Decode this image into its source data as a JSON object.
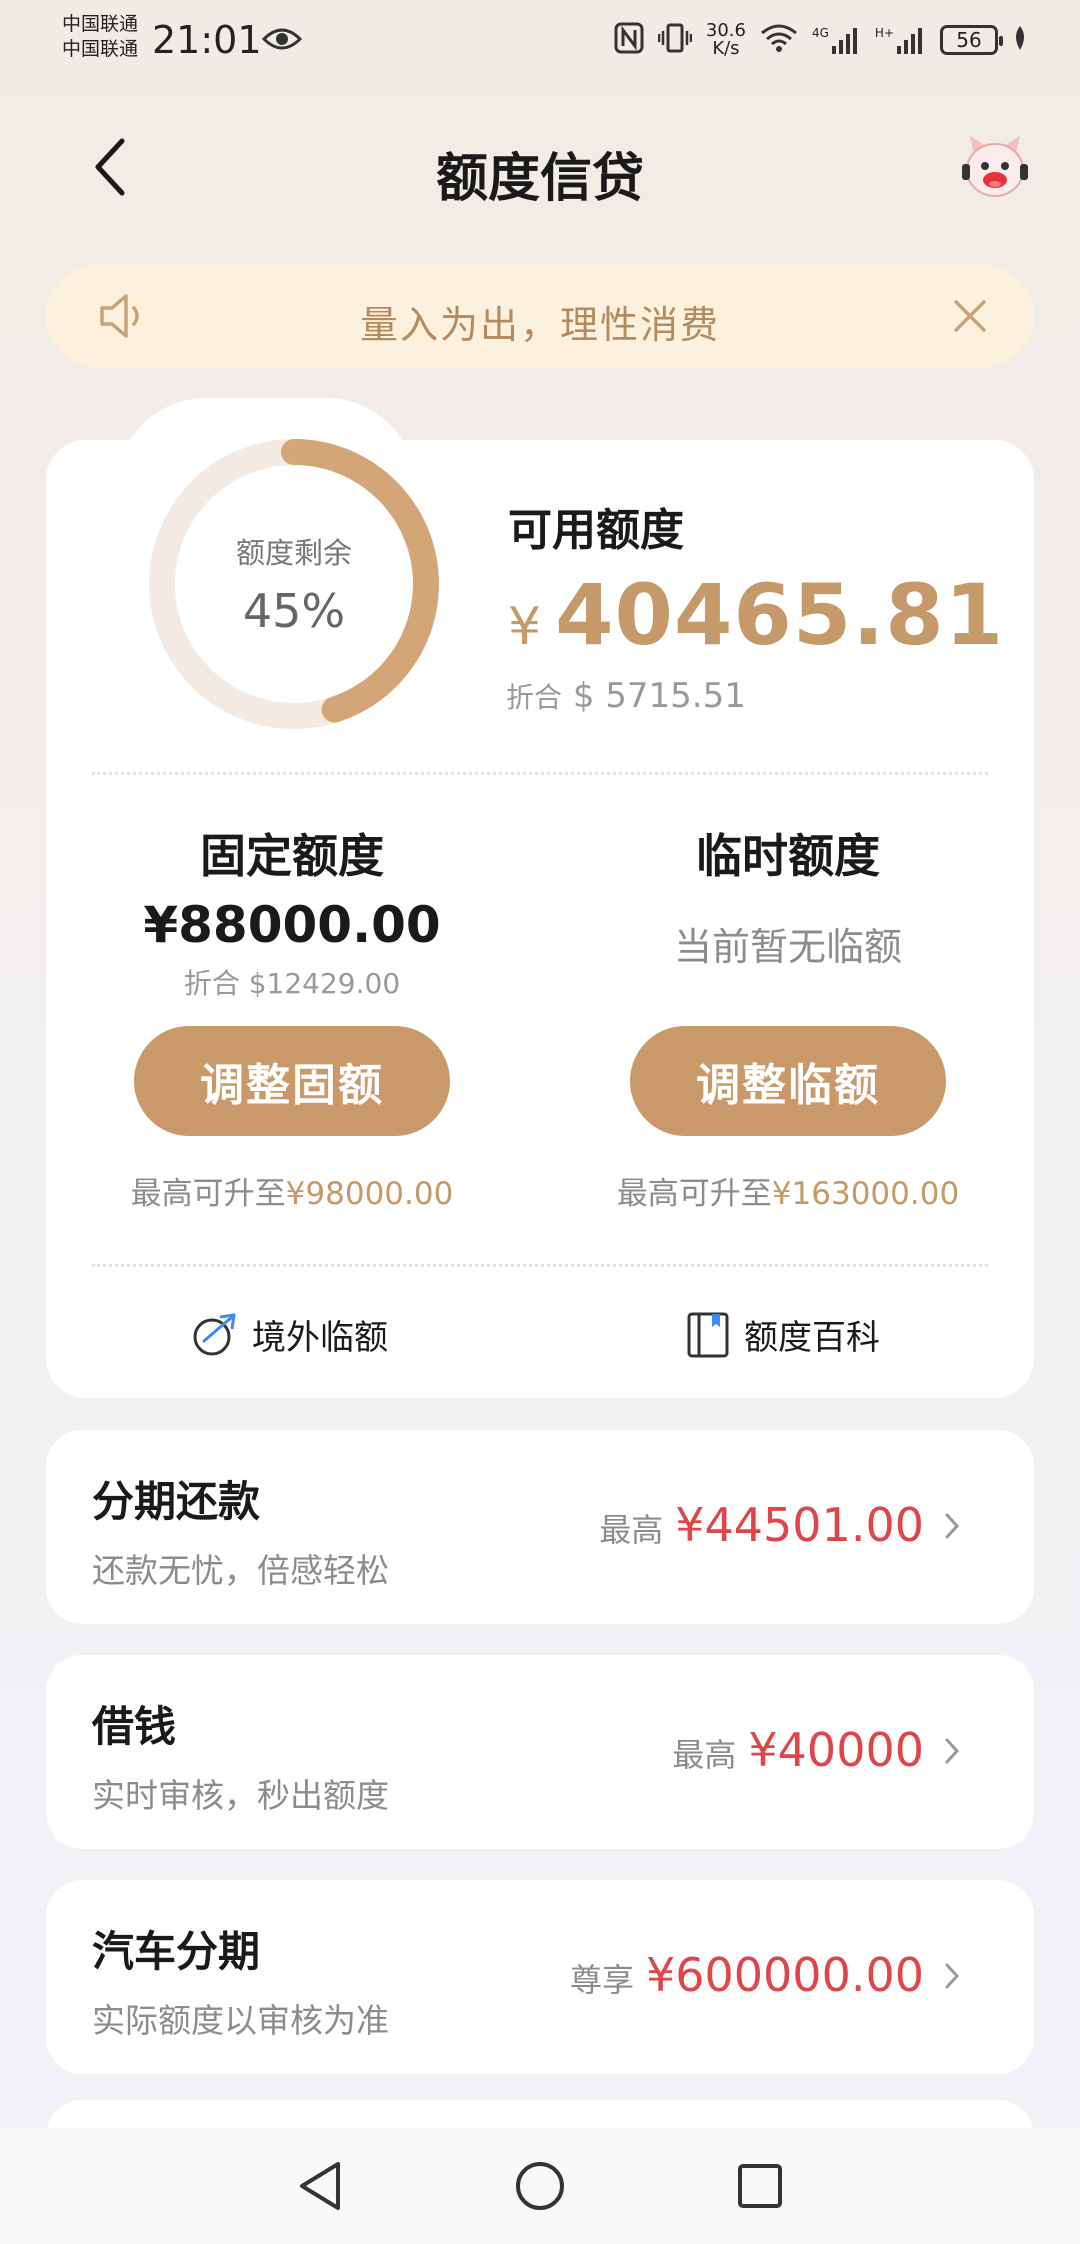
{
  "status_bar": {
    "carrier_1": "中国联通",
    "carrier_2": "中国联通",
    "time": "21:01",
    "speed_value": "30.6",
    "speed_unit": "K/s",
    "network_1": "4G",
    "network_2": "H+",
    "battery": "56"
  },
  "header": {
    "title": "额度信贷"
  },
  "notice": {
    "text": "量入为出，理性消费"
  },
  "credit": {
    "ring_label": "额度剩余",
    "ring_percent": "45%",
    "ring_fraction": 0.45,
    "available_label": "可用额度",
    "currency_symbol": "¥",
    "available_amount": "40465.81",
    "usd_prefix": "折合",
    "usd_amount": "$ 5715.51"
  },
  "fixed": {
    "title": "固定额度",
    "amount": "¥88000.00",
    "usd": "折合 $12429.00",
    "button": "调整固额",
    "max_prefix": "最高可升至",
    "max_amount": "¥98000.00"
  },
  "temp": {
    "title": "临时额度",
    "status": "当前暂无临额",
    "button": "调整临额",
    "max_prefix": "最高可升至",
    "max_amount": "¥163000.00"
  },
  "links": {
    "overseas": "境外临额",
    "wiki": "额度百科"
  },
  "list": [
    {
      "title": "分期还款",
      "subtitle": "还款无忧，倍感轻松",
      "prefix": "最高",
      "amount": "¥44501.00"
    },
    {
      "title": "借钱",
      "subtitle": "实时审核，秒出额度",
      "prefix": "最高",
      "amount": "¥40000"
    },
    {
      "title": "汽车分期",
      "subtitle": "实际额度以审核为准",
      "prefix": "尊享",
      "amount": "¥600000.00"
    }
  ],
  "colors": {
    "gold": "#c6996a",
    "red": "#e0454a",
    "notice_bg": "#fbf1dc"
  }
}
